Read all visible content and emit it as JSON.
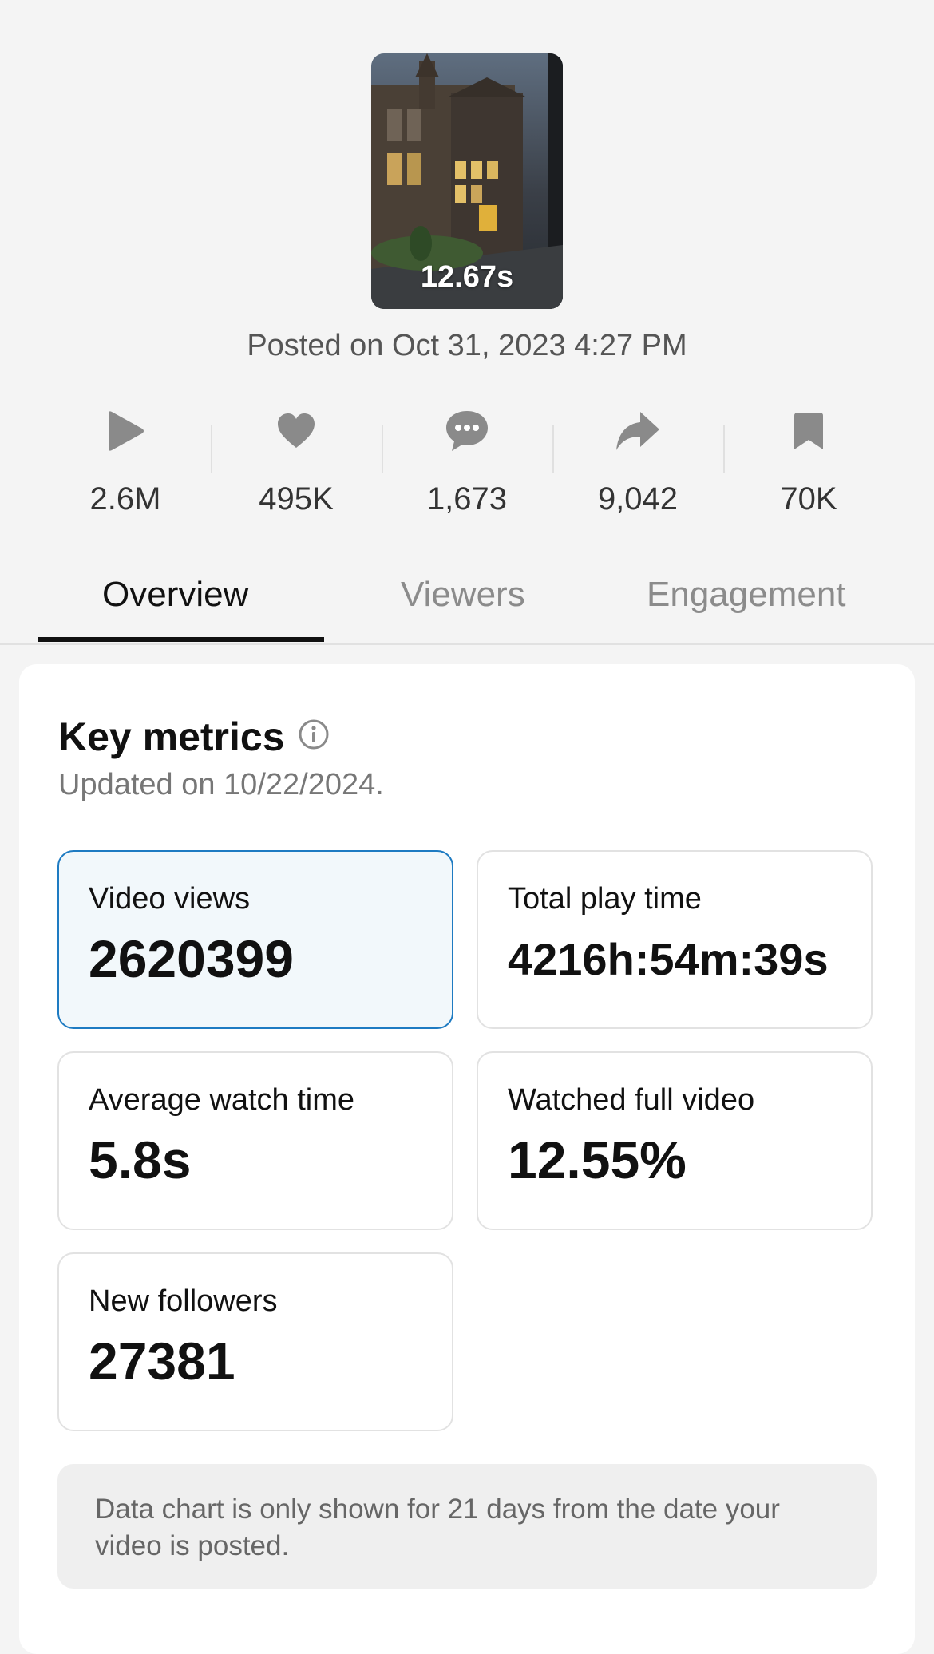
{
  "video": {
    "duration": "12.67s",
    "posted": "Posted on Oct 31, 2023 4:27 PM"
  },
  "stats": [
    {
      "icon": "play-icon",
      "value": "2.6M"
    },
    {
      "icon": "heart-icon",
      "value": "495K"
    },
    {
      "icon": "comment-icon",
      "value": "1,673"
    },
    {
      "icon": "share-icon",
      "value": "9,042"
    },
    {
      "icon": "bookmark-icon",
      "value": "70K"
    }
  ],
  "tabs": {
    "overview": "Overview",
    "viewers": "Viewers",
    "engagement": "Engagement"
  },
  "key_metrics": {
    "title": "Key metrics",
    "updated": "Updated on 10/22/2024.",
    "video_views": {
      "label": "Video views",
      "value": "2620399"
    },
    "total_play_time": {
      "label": "Total play time",
      "value": "4216h:54m:39s"
    },
    "average_watch_time": {
      "label": "Average watch time",
      "value": "5.8s"
    },
    "watched_full_video": {
      "label": "Watched full video",
      "value": "12.55%"
    },
    "new_followers": {
      "label": "New followers",
      "value": "27381"
    }
  },
  "note": "Data chart is only shown for 21 days from the date your video is posted.",
  "colors": {
    "selected_border": "#1e7bc2",
    "selected_bg": "#f2f8fb",
    "icon_gray": "#8a8a8a"
  }
}
